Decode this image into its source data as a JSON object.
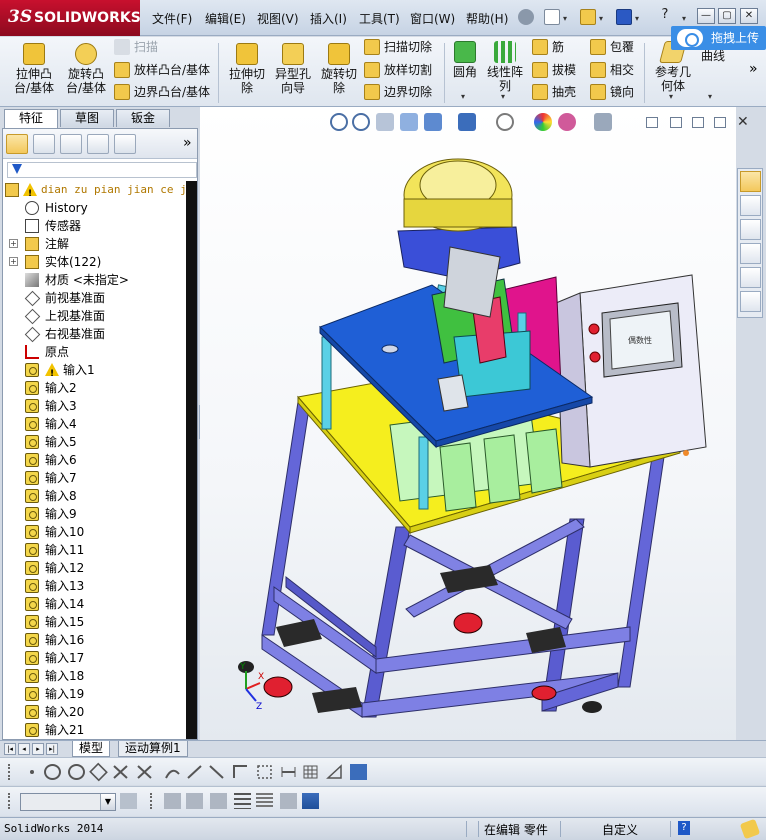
{
  "app": {
    "logo_text": "SOLIDWORKS",
    "logo_prefix": "3S"
  },
  "menu": [
    {
      "label": "文件(F)"
    },
    {
      "label": "编辑(E)"
    },
    {
      "label": "视图(V)"
    },
    {
      "label": "插入(I)"
    },
    {
      "label": "工具(T)"
    },
    {
      "label": "窗口(W)"
    },
    {
      "label": "帮助(H)"
    }
  ],
  "window_controls": {
    "minimize": "—",
    "restore": "▢",
    "close": "✕",
    "help": "?"
  },
  "upload_button": {
    "label": "拖拽上传"
  },
  "ribbon": {
    "extruded_boss": "拉伸凸台/基体",
    "revolved_boss": "旋转凸台/基体",
    "swept_boss": "扫描",
    "lofted_boss": "放样凸台/基体",
    "boundary_boss": "边界凸台/基体",
    "extruded_cut": "拉伸切除",
    "hole_wizard": "异型孔向导",
    "revolved_cut": "旋转切除",
    "swept_cut": "扫描切除",
    "lofted_cut": "放样切割",
    "boundary_cut": "边界切除",
    "fillet": "圆角",
    "linear_pattern": "线性阵列",
    "rib": "筋",
    "draft": "拔模",
    "shell": "抽壳",
    "wrap": "包覆",
    "intersect": "相交",
    "mirror": "镜向",
    "reference_geometry": "参考几何体",
    "curves": "曲线",
    "more": "»"
  },
  "cm_tabs": [
    {
      "label": "特征",
      "active": true
    },
    {
      "label": "草图",
      "active": false
    },
    {
      "label": "钣金",
      "active": false
    }
  ],
  "feature_manager": {
    "more": "»",
    "part_name": "dian zu pian jian ce ji",
    "part_suffix": "(",
    "items": [
      {
        "label": "History",
        "icon": "history-icon"
      },
      {
        "label": "传感器",
        "icon": "sensor-icon"
      },
      {
        "label": "注解",
        "icon": "annotation-icon",
        "expand": "+"
      },
      {
        "label": "实体(122)",
        "icon": "solid-bodies-icon",
        "expand": "+"
      },
      {
        "label": "材质 <未指定>",
        "icon": "material-icon"
      },
      {
        "label": "前视基准面",
        "icon": "plane-icon"
      },
      {
        "label": "上视基准面",
        "icon": "plane-icon"
      },
      {
        "label": "右视基准面",
        "icon": "plane-icon"
      },
      {
        "label": "原点",
        "icon": "origin-icon"
      },
      {
        "label": "输入1",
        "icon": "imported-body-icon",
        "warning": true
      },
      {
        "label": "输入2",
        "icon": "imported-body-icon"
      },
      {
        "label": "输入3",
        "icon": "imported-body-icon"
      },
      {
        "label": "输入4",
        "icon": "imported-body-icon"
      },
      {
        "label": "输入5",
        "icon": "imported-body-icon"
      },
      {
        "label": "输入6",
        "icon": "imported-body-icon"
      },
      {
        "label": "输入7",
        "icon": "imported-body-icon"
      },
      {
        "label": "输入8",
        "icon": "imported-body-icon"
      },
      {
        "label": "输入9",
        "icon": "imported-body-icon"
      },
      {
        "label": "输入10",
        "icon": "imported-body-icon"
      },
      {
        "label": "输入11",
        "icon": "imported-body-icon"
      },
      {
        "label": "输入12",
        "icon": "imported-body-icon"
      },
      {
        "label": "输入13",
        "icon": "imported-body-icon"
      },
      {
        "label": "输入14",
        "icon": "imported-body-icon"
      },
      {
        "label": "输入15",
        "icon": "imported-body-icon"
      },
      {
        "label": "输入16",
        "icon": "imported-body-icon"
      },
      {
        "label": "输入17",
        "icon": "imported-body-icon"
      },
      {
        "label": "输入18",
        "icon": "imported-body-icon"
      },
      {
        "label": "输入19",
        "icon": "imported-body-icon"
      },
      {
        "label": "输入20",
        "icon": "imported-body-icon"
      },
      {
        "label": "输入21",
        "icon": "imported-body-icon"
      }
    ]
  },
  "bottom_tabs": [
    {
      "label": "模型",
      "active": true
    },
    {
      "label": "运动算例1",
      "active": false
    }
  ],
  "statusbar": {
    "app_version": "SolidWorks 2014",
    "mode": "在编辑 零件",
    "units": "自定义",
    "help": "?"
  },
  "hmi_screen_text": "偶数性",
  "triad": {
    "x": "X",
    "y": "Y",
    "z": "Z"
  },
  "colors": {
    "brand_red": "#c8102e",
    "table_blue": "#1f5fd6",
    "frame_blue": "#5a5fd0",
    "base_yellow": "#f5ee1e",
    "bin_green": "#b9f5b0",
    "hopper_yellow": "#f2e45a",
    "magenta": "#e0148c",
    "cabinet": "#e6e4f4",
    "wheel_red": "#e02030"
  }
}
